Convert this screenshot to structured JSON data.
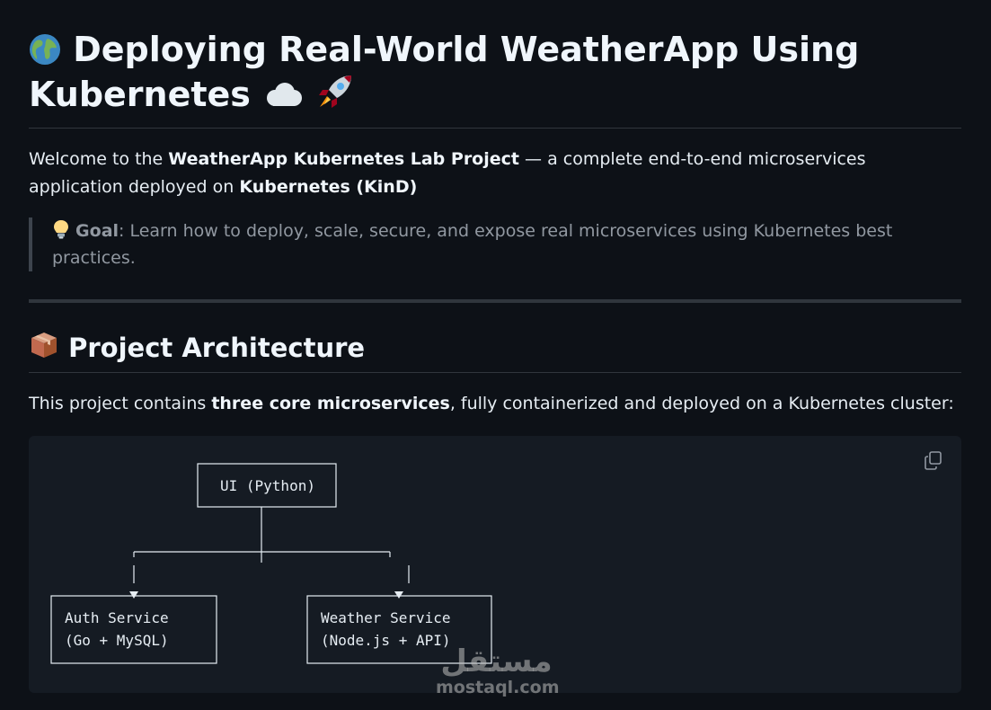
{
  "header": {
    "title_icon": "globe-icon",
    "title_line1": "Deploying Real-World WeatherApp Using",
    "title_line2": "Kubernetes",
    "title_trailing_icons": [
      "cloud-icon",
      "rocket-icon"
    ]
  },
  "intro": {
    "prefix": "Welcome to the ",
    "project_name": "WeatherApp Kubernetes Lab Project",
    "middle": " — a complete end-to-end microservices application deployed on ",
    "platform": "Kubernetes (KinD)"
  },
  "goal": {
    "icon": "lightbulb-icon",
    "label": "Goal",
    "text": ": Learn how to deploy, scale, secure, and expose real microservices using Kubernetes best practices."
  },
  "architecture": {
    "heading_icon": "package-icon",
    "heading": "Project Architecture",
    "desc_prefix": "This project contains ",
    "desc_bold": "three core microservices",
    "desc_suffix": ", fully containerized and deployed on a Kubernetes cluster:"
  },
  "diagram": {
    "ui_label": "UI (Python)",
    "auth_line1": "Auth Service",
    "auth_line2": "(Go + MySQL)",
    "weather_line1": "Weather Service",
    "weather_line2": "(Node.js + API)",
    "copy_icon": "copy-icon"
  },
  "watermark": {
    "arabic": "مستقل",
    "latin": "mostaql.com"
  }
}
